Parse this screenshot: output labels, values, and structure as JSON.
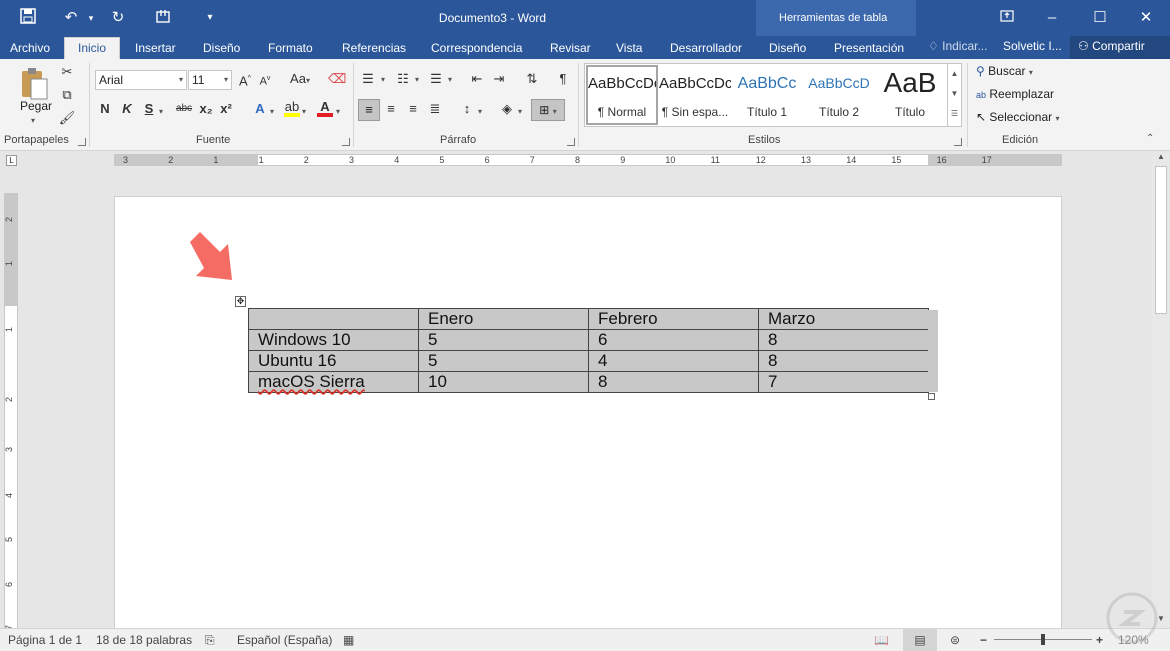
{
  "window": {
    "title": "Documento3 - Word",
    "context_tab_group": "Herramientas de tabla",
    "user": "Solvetic I...",
    "tell_me": "Indicar...",
    "share": "Compartir"
  },
  "tabs": [
    "Archivo",
    "Inicio",
    "Insertar",
    "Diseño",
    "Formato",
    "Referencias",
    "Correspondencia",
    "Revisar",
    "Vista",
    "Desarrollador",
    "Diseño",
    "Presentación"
  ],
  "ribbon": {
    "paste_label": "Pegar",
    "font_name": "Arial",
    "font_size": "11",
    "case_label": "Aa",
    "font_bold": "N",
    "font_italic": "K",
    "font_underline": "S",
    "strike": "abc",
    "subscript": "x₂",
    "superscript": "x²",
    "groups": {
      "clipboard": "Portapapeles",
      "font": "Fuente",
      "paragraph": "Párrafo",
      "styles": "Estilos",
      "editing": "Edición"
    },
    "styles": [
      {
        "sample": "AaBbCcDc",
        "name": "¶ Normal"
      },
      {
        "sample": "AaBbCcDc",
        "name": "¶ Sin espa..."
      },
      {
        "sample": "AaBbCc",
        "name": "Título 1"
      },
      {
        "sample": "AaBbCcD",
        "name": "Título 2"
      },
      {
        "sample": "AaB",
        "name": "Título"
      }
    ],
    "editing": {
      "find": "Buscar",
      "replace": "Reemplazar",
      "select": "Seleccionar"
    }
  },
  "ruler": {
    "horizontal": [
      "3",
      "2",
      "1",
      "1",
      "2",
      "3",
      "4",
      "5",
      "6",
      "7",
      "8",
      "9",
      "10",
      "11",
      "12",
      "13",
      "14",
      "15",
      "16",
      "17"
    ],
    "vertical": [
      "2",
      "1",
      "1",
      "2",
      "3",
      "4",
      "5",
      "6",
      "7"
    ]
  },
  "table": {
    "header": [
      "",
      "Enero",
      "Febrero",
      "Marzo"
    ],
    "rows": [
      [
        "Windows 10",
        "5",
        "6",
        "8"
      ],
      [
        "Ubuntu 16",
        "5",
        "4",
        "8"
      ],
      [
        "macOS Sierra",
        "10",
        "8",
        "7"
      ]
    ]
  },
  "status": {
    "page": "Página 1 de 1",
    "words": "18 de 18 palabras",
    "language": "Español (España)",
    "zoom": "120%"
  },
  "colors": {
    "brand": "#2b579a",
    "arrow": "#f4645c",
    "cell_shading": "#c8c8c8"
  }
}
